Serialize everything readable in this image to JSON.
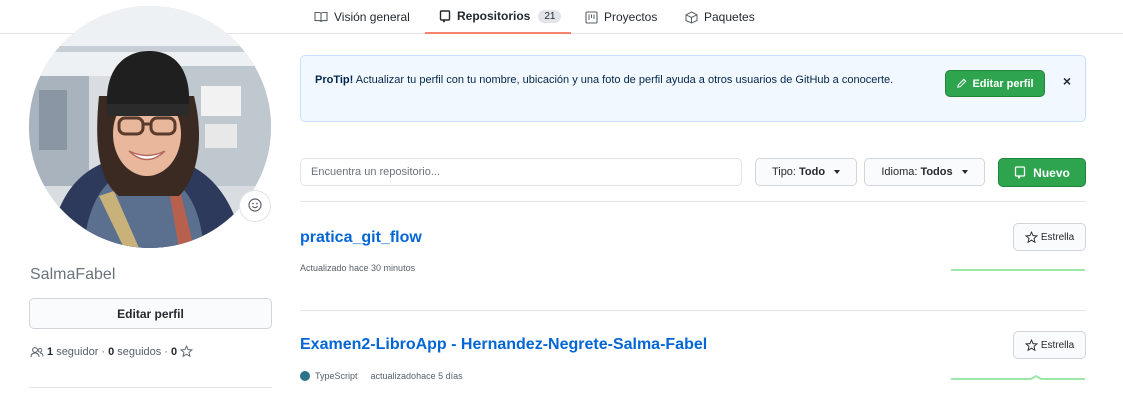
{
  "tabs": [
    {
      "label": "Visión general",
      "icon": "book-icon"
    },
    {
      "label": "Repositorios",
      "icon": "repo-icon",
      "count": "21",
      "active": true
    },
    {
      "label": "Proyectos",
      "icon": "project-icon"
    },
    {
      "label": "Paquetes",
      "icon": "package-icon"
    }
  ],
  "profile": {
    "username": "SalmaFabel",
    "edit_label": "Editar perfil",
    "followers_count": "1",
    "followers_label": "seguidor",
    "following_count": "0",
    "following_label": "seguidos",
    "stars_count": "0",
    "separator": "·"
  },
  "protip": {
    "title": "ProTip!",
    "text": "Actualizar tu perfil con tu nombre, ubicación y una foto de perfil ayuda a otros usuarios de GitHub a conocerte.",
    "button_label": "Editar perfil",
    "close_label": "×"
  },
  "filters": {
    "search_placeholder": "Encuentra un repositorio...",
    "type_label": "Tipo:",
    "type_value": "Todo",
    "language_label": "Idioma:",
    "language_value": "Todos",
    "new_label": "Nuevo"
  },
  "repos": [
    {
      "name": "pratica_git_flow",
      "updated": "Actualizado hace 30 minutos",
      "star_label": "Estrella"
    },
    {
      "name": "Examen2-LibroApp - Hernandez-Negrete-Salma-Fabel",
      "language": "TypeScript",
      "language_color": "#2b7489",
      "updated": "actualizadohace 5 días",
      "star_label": "Estrella"
    }
  ],
  "colors": {
    "accent_green": "#2ea44f",
    "link_blue": "#0366d6",
    "active_tab_underline": "#f9826c",
    "protip_bg": "#f1f8ff"
  }
}
